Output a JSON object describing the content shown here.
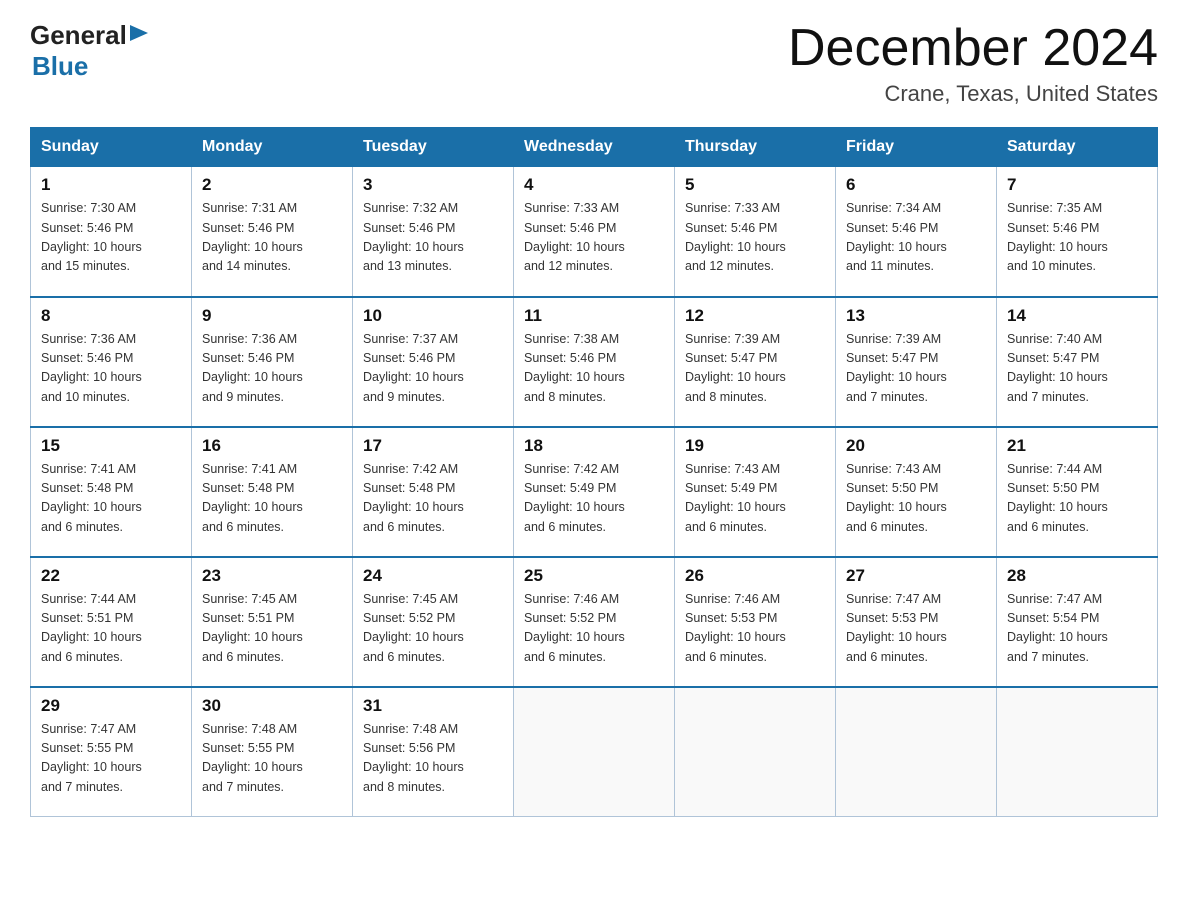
{
  "header": {
    "logo": {
      "text1": "General",
      "arrow": "▶",
      "text2": "Blue"
    },
    "title": "December 2024",
    "subtitle": "Crane, Texas, United States"
  },
  "days_of_week": [
    "Sunday",
    "Monday",
    "Tuesday",
    "Wednesday",
    "Thursday",
    "Friday",
    "Saturday"
  ],
  "weeks": [
    [
      {
        "day": "1",
        "sunrise": "7:30 AM",
        "sunset": "5:46 PM",
        "daylight": "10 hours and 15 minutes."
      },
      {
        "day": "2",
        "sunrise": "7:31 AM",
        "sunset": "5:46 PM",
        "daylight": "10 hours and 14 minutes."
      },
      {
        "day": "3",
        "sunrise": "7:32 AM",
        "sunset": "5:46 PM",
        "daylight": "10 hours and 13 minutes."
      },
      {
        "day": "4",
        "sunrise": "7:33 AM",
        "sunset": "5:46 PM",
        "daylight": "10 hours and 12 minutes."
      },
      {
        "day": "5",
        "sunrise": "7:33 AM",
        "sunset": "5:46 PM",
        "daylight": "10 hours and 12 minutes."
      },
      {
        "day": "6",
        "sunrise": "7:34 AM",
        "sunset": "5:46 PM",
        "daylight": "10 hours and 11 minutes."
      },
      {
        "day": "7",
        "sunrise": "7:35 AM",
        "sunset": "5:46 PM",
        "daylight": "10 hours and 10 minutes."
      }
    ],
    [
      {
        "day": "8",
        "sunrise": "7:36 AM",
        "sunset": "5:46 PM",
        "daylight": "10 hours and 10 minutes."
      },
      {
        "day": "9",
        "sunrise": "7:36 AM",
        "sunset": "5:46 PM",
        "daylight": "10 hours and 9 minutes."
      },
      {
        "day": "10",
        "sunrise": "7:37 AM",
        "sunset": "5:46 PM",
        "daylight": "10 hours and 9 minutes."
      },
      {
        "day": "11",
        "sunrise": "7:38 AM",
        "sunset": "5:46 PM",
        "daylight": "10 hours and 8 minutes."
      },
      {
        "day": "12",
        "sunrise": "7:39 AM",
        "sunset": "5:47 PM",
        "daylight": "10 hours and 8 minutes."
      },
      {
        "day": "13",
        "sunrise": "7:39 AM",
        "sunset": "5:47 PM",
        "daylight": "10 hours and 7 minutes."
      },
      {
        "day": "14",
        "sunrise": "7:40 AM",
        "sunset": "5:47 PM",
        "daylight": "10 hours and 7 minutes."
      }
    ],
    [
      {
        "day": "15",
        "sunrise": "7:41 AM",
        "sunset": "5:48 PM",
        "daylight": "10 hours and 6 minutes."
      },
      {
        "day": "16",
        "sunrise": "7:41 AM",
        "sunset": "5:48 PM",
        "daylight": "10 hours and 6 minutes."
      },
      {
        "day": "17",
        "sunrise": "7:42 AM",
        "sunset": "5:48 PM",
        "daylight": "10 hours and 6 minutes."
      },
      {
        "day": "18",
        "sunrise": "7:42 AM",
        "sunset": "5:49 PM",
        "daylight": "10 hours and 6 minutes."
      },
      {
        "day": "19",
        "sunrise": "7:43 AM",
        "sunset": "5:49 PM",
        "daylight": "10 hours and 6 minutes."
      },
      {
        "day": "20",
        "sunrise": "7:43 AM",
        "sunset": "5:50 PM",
        "daylight": "10 hours and 6 minutes."
      },
      {
        "day": "21",
        "sunrise": "7:44 AM",
        "sunset": "5:50 PM",
        "daylight": "10 hours and 6 minutes."
      }
    ],
    [
      {
        "day": "22",
        "sunrise": "7:44 AM",
        "sunset": "5:51 PM",
        "daylight": "10 hours and 6 minutes."
      },
      {
        "day": "23",
        "sunrise": "7:45 AM",
        "sunset": "5:51 PM",
        "daylight": "10 hours and 6 minutes."
      },
      {
        "day": "24",
        "sunrise": "7:45 AM",
        "sunset": "5:52 PM",
        "daylight": "10 hours and 6 minutes."
      },
      {
        "day": "25",
        "sunrise": "7:46 AM",
        "sunset": "5:52 PM",
        "daylight": "10 hours and 6 minutes."
      },
      {
        "day": "26",
        "sunrise": "7:46 AM",
        "sunset": "5:53 PM",
        "daylight": "10 hours and 6 minutes."
      },
      {
        "day": "27",
        "sunrise": "7:47 AM",
        "sunset": "5:53 PM",
        "daylight": "10 hours and 6 minutes."
      },
      {
        "day": "28",
        "sunrise": "7:47 AM",
        "sunset": "5:54 PM",
        "daylight": "10 hours and 7 minutes."
      }
    ],
    [
      {
        "day": "29",
        "sunrise": "7:47 AM",
        "sunset": "5:55 PM",
        "daylight": "10 hours and 7 minutes."
      },
      {
        "day": "30",
        "sunrise": "7:48 AM",
        "sunset": "5:55 PM",
        "daylight": "10 hours and 7 minutes."
      },
      {
        "day": "31",
        "sunrise": "7:48 AM",
        "sunset": "5:56 PM",
        "daylight": "10 hours and 8 minutes."
      },
      null,
      null,
      null,
      null
    ]
  ],
  "labels": {
    "sunrise": "Sunrise:",
    "sunset": "Sunset:",
    "daylight": "Daylight:"
  }
}
